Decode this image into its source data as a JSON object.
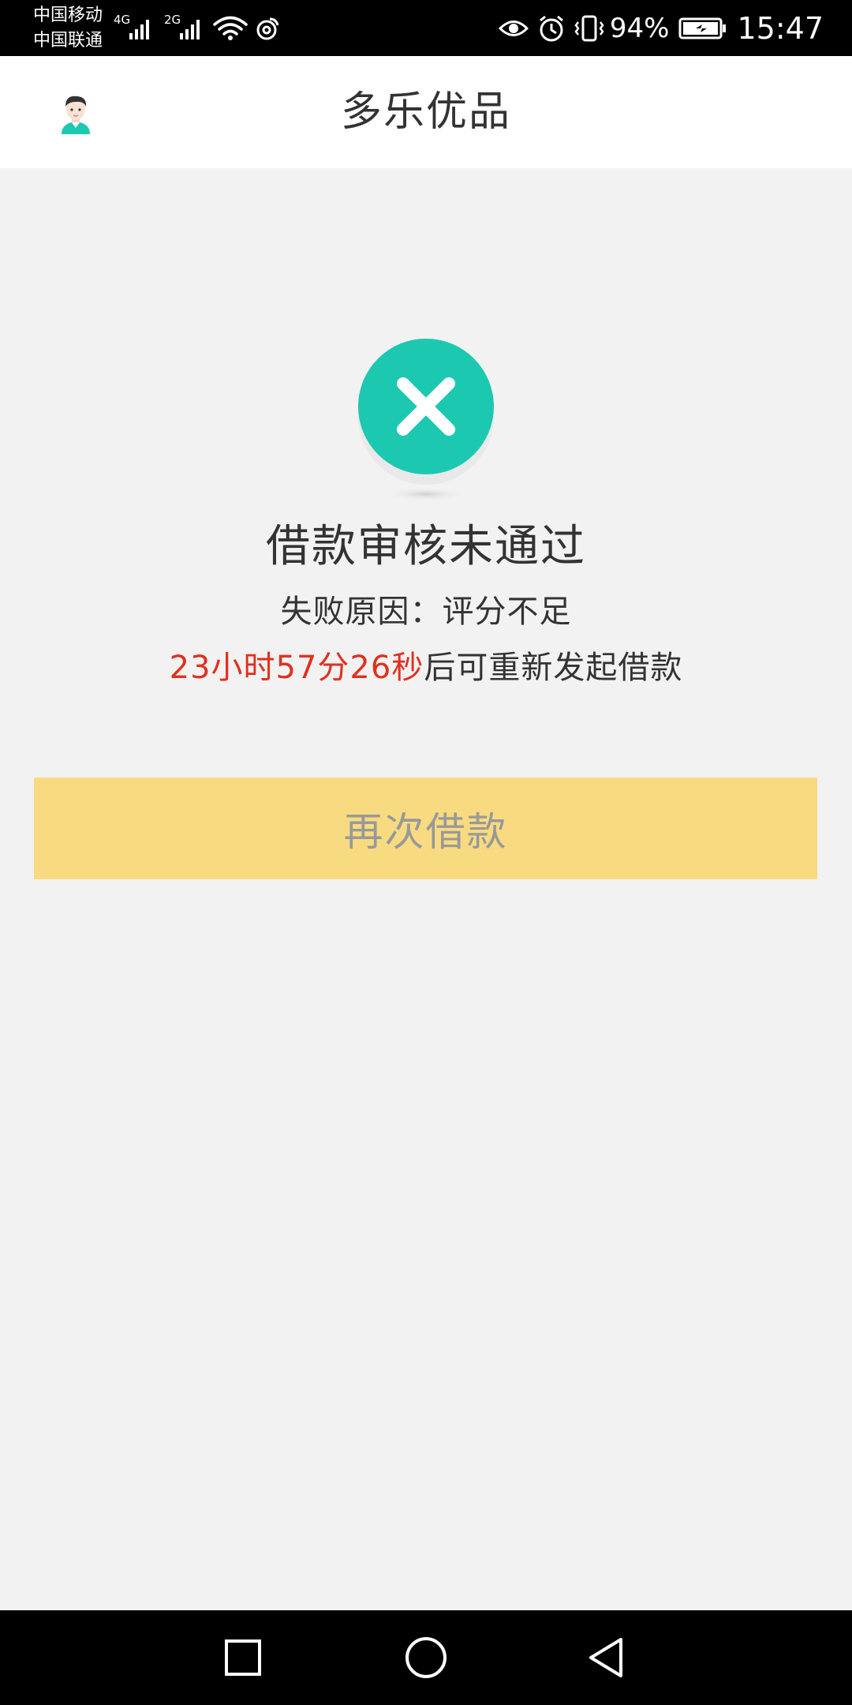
{
  "status_bar": {
    "carrier_1": "中国移动",
    "carrier_2": "中国联通",
    "net_1": "4G",
    "net_2": "2G",
    "battery_percent": "94%",
    "time": "15:47",
    "icons": [
      "signal-icon",
      "wifi-icon",
      "weibo-icon",
      "eye-icon",
      "alarm-icon",
      "vibrate-icon",
      "battery-icon"
    ]
  },
  "header": {
    "title": "多乐优品",
    "avatar_icon": "avatar-icon"
  },
  "result": {
    "icon": "close-circle-icon",
    "accent_color": "#1dc8b1",
    "title": "借款审核未通过",
    "reason": "失败原因：评分不足",
    "countdown": "23小时57分26秒",
    "countdown_color": "#e0301e",
    "countdown_suffix": "后可重新发起借款"
  },
  "button": {
    "label": "再次借款",
    "color": "#f8db80"
  },
  "nav": {
    "icons": [
      "recent-apps-icon",
      "home-icon",
      "back-icon"
    ]
  }
}
